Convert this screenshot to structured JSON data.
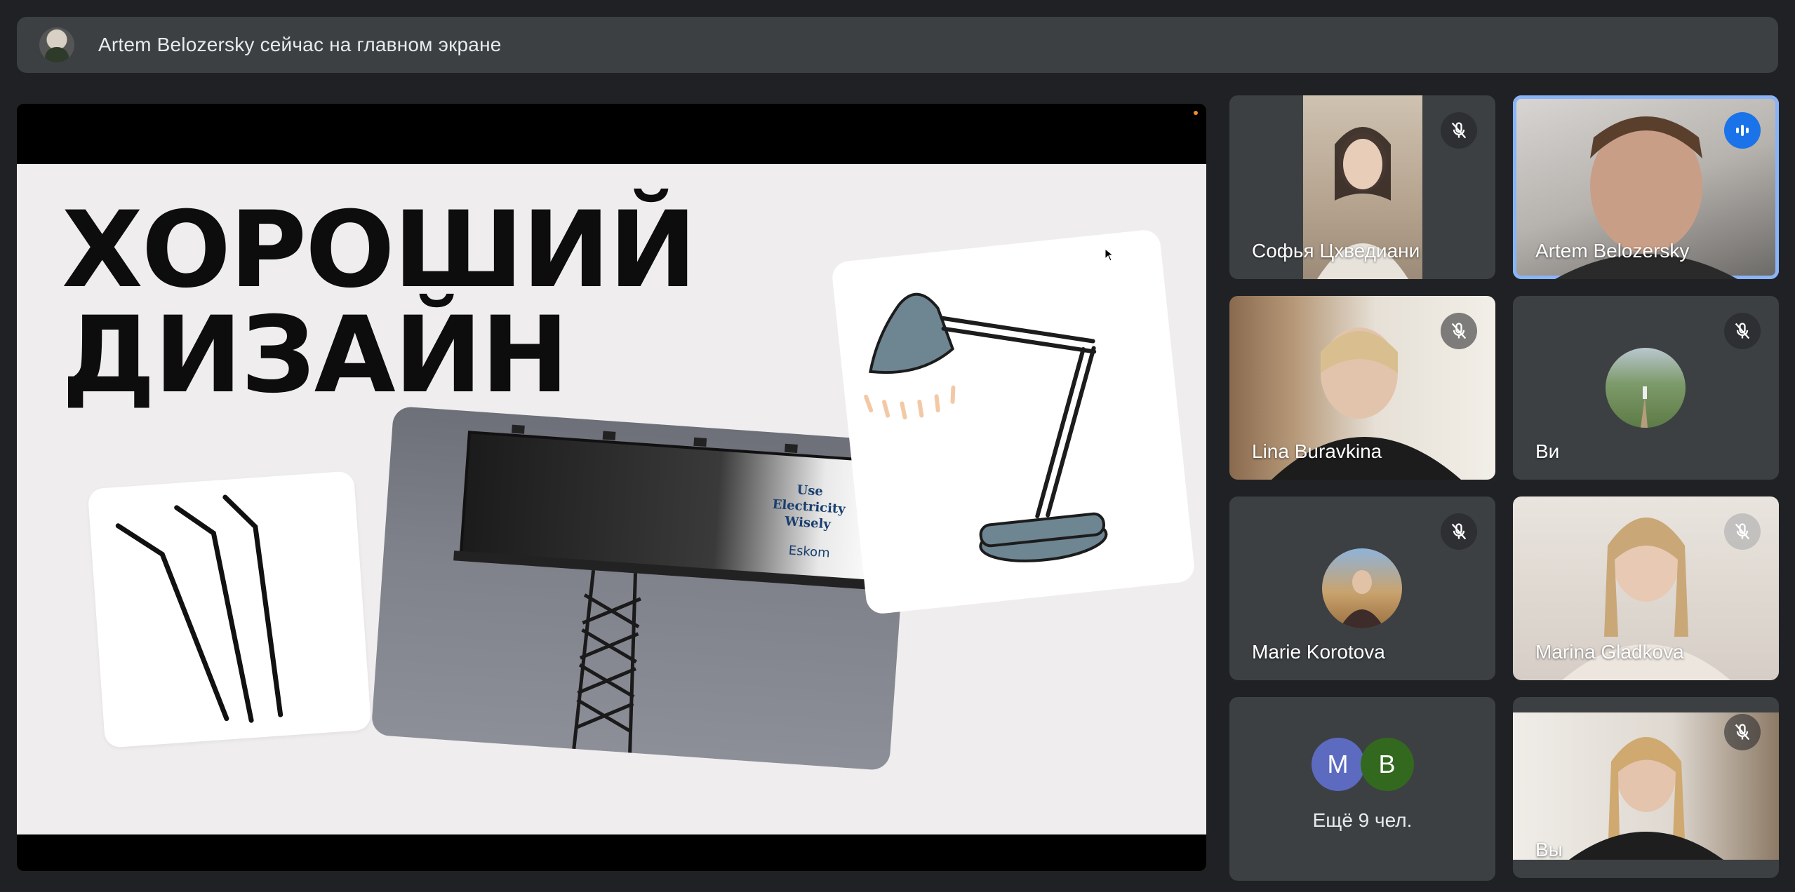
{
  "banner": {
    "text": "Artem Belozersky сейчас на главном экране",
    "avatar_icon": "presenter-avatar"
  },
  "slide": {
    "title_line1": "ХОРОШИЙ",
    "title_line2": "ДИЗАЙН",
    "billboard_text_1": "Use",
    "billboard_text_2": "Electricity",
    "billboard_text_3": "Wisely",
    "billboard_brand": "Eskom"
  },
  "participants": [
    {
      "name": "Софья Цхведиани",
      "muted": true,
      "kind": "video"
    },
    {
      "name": "Artem Belozersky",
      "speaking": true,
      "kind": "video"
    },
    {
      "name": "Lina Buravkina",
      "muted": true,
      "kind": "video"
    },
    {
      "name": "Ви",
      "muted": true,
      "kind": "avatar"
    },
    {
      "name": "Marie Korotova",
      "muted": true,
      "kind": "avatar"
    },
    {
      "name": "Marina Gladkova",
      "muted": true,
      "kind": "video"
    },
    {
      "name": "Вы",
      "muted": true,
      "kind": "video"
    }
  ],
  "more": {
    "avatar1_letter": "M",
    "avatar2_letter": "B",
    "avatar1_color": "#5c6bc0",
    "avatar2_color": "#33691e",
    "label": "Ещё 9 чел."
  },
  "colors": {
    "background": "#202124",
    "tile": "#3c4043",
    "speaking_ring": "#8ab4f8",
    "speaking_badge": "#1a73e8"
  }
}
